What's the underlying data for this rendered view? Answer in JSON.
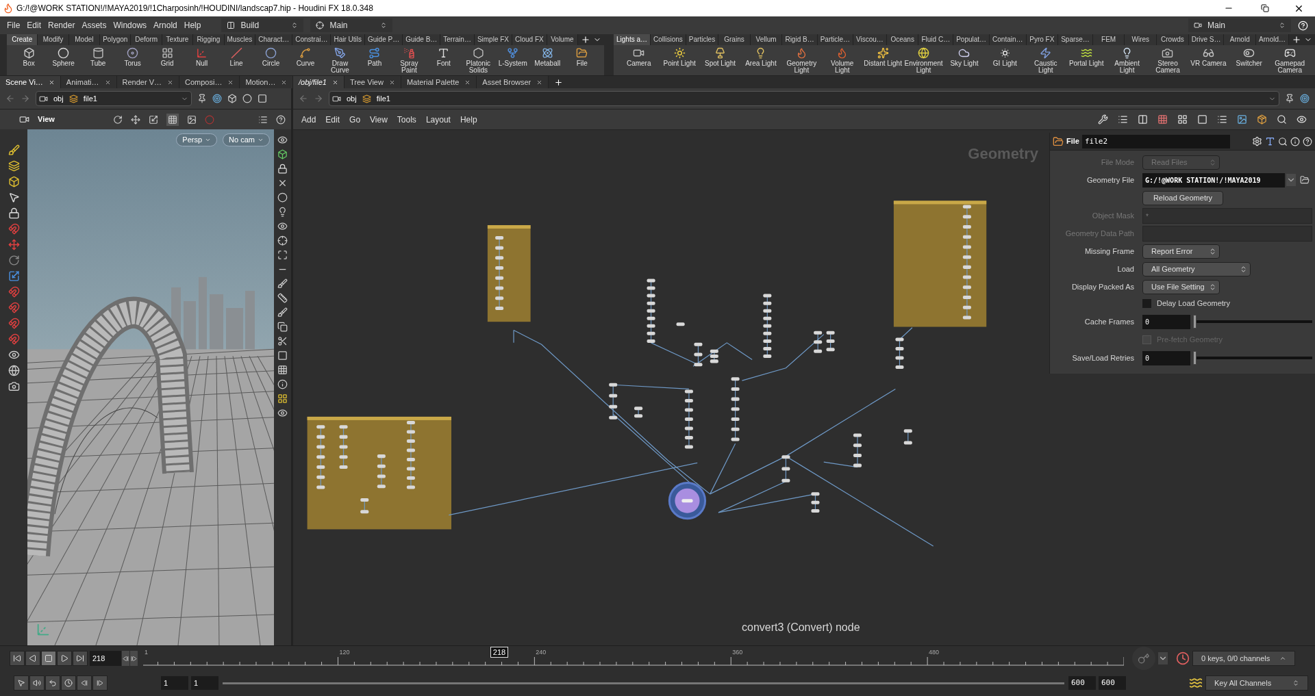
{
  "window": {
    "title": "G:/!@WORK STATION!/!MAYA2019/!1Charposinh/!HOUDINI/landscap7.hip - Houdini FX 18.0.348"
  },
  "menu": [
    "File",
    "Edit",
    "Render",
    "Assets",
    "Windows",
    "Arnold",
    "Help"
  ],
  "desktops": [
    {
      "label": "Build"
    },
    {
      "label": "Main"
    }
  ],
  "right_desktop": {
    "label": "Main"
  },
  "shelf_left": {
    "tabs": [
      {
        "label": "Create",
        "selected": true
      },
      {
        "label": "Modify",
        "selected": false
      },
      {
        "label": "Model",
        "selected": false
      },
      {
        "label": "Polygon",
        "selected": false
      },
      {
        "label": "Deform",
        "selected": false
      },
      {
        "label": "Texture",
        "selected": false
      },
      {
        "label": "Rigging",
        "selected": false
      },
      {
        "label": "Muscles",
        "selected": false
      },
      {
        "label": "Charact…",
        "selected": false
      },
      {
        "label": "Constrai…",
        "selected": false
      },
      {
        "label": "Hair Utils",
        "selected": false
      },
      {
        "label": "Guide P…",
        "selected": false
      },
      {
        "label": "Guide B…",
        "selected": false
      },
      {
        "label": "Terrain…",
        "selected": false
      },
      {
        "label": "Simple FX",
        "selected": false
      },
      {
        "label": "Cloud FX",
        "selected": false
      },
      {
        "label": "Volume",
        "selected": false
      }
    ],
    "tools": [
      "Box",
      "Sphere",
      "Tube",
      "Torus",
      "Grid",
      "Null",
      "Line",
      "Circle",
      "Curve",
      "Draw Curve",
      "Path",
      "Spray Paint",
      "Font",
      "Platonic Solids",
      "L-System",
      "Metaball",
      "File"
    ]
  },
  "shelf_right": {
    "tabs": [
      {
        "label": "Lights a…",
        "selected": true
      },
      {
        "label": "Collisions",
        "selected": false
      },
      {
        "label": "Particles",
        "selected": false
      },
      {
        "label": "Grains",
        "selected": false
      },
      {
        "label": "Vellum",
        "selected": false
      },
      {
        "label": "Rigid B…",
        "selected": false
      },
      {
        "label": "Particle…",
        "selected": false
      },
      {
        "label": "Viscou…",
        "selected": false
      },
      {
        "label": "Oceans",
        "selected": false
      },
      {
        "label": "Fluid C…",
        "selected": false
      },
      {
        "label": "Populat…",
        "selected": false
      },
      {
        "label": "Contain…",
        "selected": false
      },
      {
        "label": "Pyro FX",
        "selected": false
      },
      {
        "label": "Sparse…",
        "selected": false
      },
      {
        "label": "FEM",
        "selected": false
      },
      {
        "label": "Wires",
        "selected": false
      },
      {
        "label": "Crowds",
        "selected": false
      },
      {
        "label": "Drive S…",
        "selected": false
      },
      {
        "label": "Arnold",
        "selected": false
      },
      {
        "label": "Arnold…",
        "selected": false
      }
    ],
    "tools": [
      "Camera",
      "Point Light",
      "Spot Light",
      "Area Light",
      "Geometry Light",
      "Volume Light",
      "Distant Light",
      "Environment Light",
      "Sky Light",
      "GI Light",
      "Caustic Light",
      "Portal Light",
      "Ambient Light",
      "Stereo Camera",
      "VR Camera",
      "Switcher",
      "Gamepad Camera"
    ]
  },
  "left_pane": {
    "tabs": [
      {
        "label": "Scene Vi…",
        "selected": true
      },
      {
        "label": "Animati…",
        "selected": false
      },
      {
        "label": "Render V…",
        "selected": false
      },
      {
        "label": "Composi…",
        "selected": false
      },
      {
        "label": "Motion…",
        "selected": false
      }
    ],
    "path": [
      "obj",
      "file1"
    ],
    "view_label": "View",
    "camera_menus": [
      "Persp",
      "No cam"
    ]
  },
  "network_pane": {
    "tabs": [
      {
        "label": "/obj/file1",
        "selected": true
      },
      {
        "label": "Tree View",
        "selected": false
      },
      {
        "label": "Material Palette",
        "selected": false
      },
      {
        "label": "Asset Browser",
        "selected": false
      }
    ],
    "path": [
      "obj",
      "file1"
    ],
    "menu": [
      "Add",
      "Edit",
      "Go",
      "View",
      "Tools",
      "Layout",
      "Help"
    ],
    "context_label": "Geometry",
    "status": "convert3 (Convert) node"
  },
  "parameters": {
    "node_type": "File",
    "node_name": "file2",
    "rows": [
      {
        "kind": "menu",
        "label": "File Mode",
        "value": "Read Files",
        "disabled": true
      },
      {
        "kind": "file",
        "label": "Geometry File",
        "value": "G:/!@WORK STATION!/!MAYA2019",
        "disabled": false
      },
      {
        "kind": "button",
        "label": "Reload Geometry",
        "disabled": false
      },
      {
        "kind": "text",
        "label": "Object Mask",
        "value": "*",
        "disabled": true
      },
      {
        "kind": "text",
        "label": "Geometry Data Path",
        "disabled": true
      },
      {
        "kind": "menu",
        "label": "Missing Frame",
        "value": "Report Error",
        "disabled": false
      },
      {
        "kind": "menu",
        "label": "Load",
        "value": "All Geometry",
        "disabled": false
      },
      {
        "kind": "menu",
        "label": "Display Packed As",
        "value": "Use File Setting",
        "disabled": false
      },
      {
        "kind": "checkbox",
        "label": "Delay Load Geometry",
        "checked": false,
        "disabled": false
      },
      {
        "kind": "slider",
        "label": "Cache Frames",
        "value": "0",
        "level": 0,
        "disabled": false
      },
      {
        "kind": "checkbox",
        "label": "Pre-fetch Geometry",
        "checked": false,
        "disabled": true
      },
      {
        "kind": "slider",
        "label": "Save/Load Retries",
        "value": "0",
        "level": 0,
        "disabled": false
      }
    ]
  },
  "timeline": {
    "frame": "218",
    "marker": "218",
    "ticks": [
      "1",
      "120",
      "240",
      "360",
      "480"
    ],
    "start": "1",
    "start_2": "1",
    "end": "600",
    "end_2": "600",
    "range_bar": {
      "level": 1
    },
    "keys": "0 keys, 0/0 channels",
    "key_mode": "Key All Channels"
  }
}
